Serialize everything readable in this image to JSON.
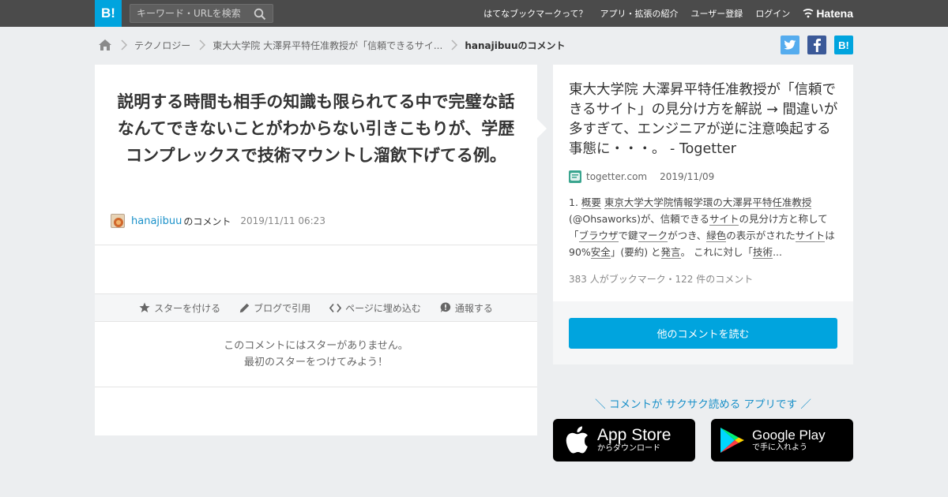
{
  "header": {
    "logo_text": "B!",
    "search_placeholder": "キーワード・URLを検索",
    "nav": [
      "はてなブックマークって？",
      "アプリ・拡張の紹介",
      "ユーザー登録",
      "ログイン"
    ],
    "brand": "Hatena"
  },
  "breadcrumb": {
    "items": [
      "テクノロジー",
      "東大大学院 大澤昇平特任准教授が「信頼できるサイ..."
    ],
    "current": "hanajibuuのコメント"
  },
  "share": {
    "hatena": "B!"
  },
  "comment": {
    "text": "説明する時間も相手の知識も限られてる中で完璧な話なんてできないことがわからない引きこもりが、学歴コンプレックスで技術マウントし溜飲下げてる例。",
    "user": "hanajibuu",
    "user_suffix": "のコメント",
    "time": "2019/11/11 06:23"
  },
  "actions": {
    "star": "スターを付ける",
    "blog": "ブログで引用",
    "embed": "ページに埋め込む",
    "report": "通報する"
  },
  "no_stars": {
    "line1": "このコメントにはスターがありません。",
    "line2": "最初のスターをつけてみよう！"
  },
  "entry": {
    "title": "東大大学院 大澤昇平特任准教授が「信頼できるサイト」の見分け方を解説 → 間違いが多すぎて、エンジニアが逆に注意喚起する事態に・・・。 - Togetter",
    "domain": "togetter.com",
    "date": "2019/11/09",
    "summary": {
      "s1": "1. ",
      "u1": "概要",
      "s2": " ",
      "u2": "東京大学大学院情報学環の大澤昇平特任准教授",
      "s3": "(@Ohsaworks)が、信頼できる",
      "u3": "サイト",
      "s4": "の見分け方と称して「",
      "u4": "ブラウザ",
      "s5": "で鍵",
      "u5": "マーク",
      "s6": "がつき、",
      "u6": "緑色",
      "s7": "の表示がされた",
      "u7": "サイト",
      "s8": "は90%",
      "u8": "安全",
      "s9": "」(要約) と",
      "u9": "発言",
      "s10": "。 これに対し「",
      "u10": "技術",
      "s11": "..."
    },
    "counts": "383 人がブックマーク・122 件のコメント",
    "more_button": "他のコメントを読む"
  },
  "app_promo": {
    "tagline": "＼ コメントが サクサク読める アプリです ／",
    "appstore_main": "App Store",
    "appstore_sub": "からダウンロード",
    "googleplay_main": "Google Play",
    "googleplay_sub": "で手に入れよう"
  },
  "colors": {
    "topbar": "#4b4b4b",
    "brand_blue": "#00a4de",
    "link_blue": "#1b91c9",
    "twitter": "#55acee",
    "facebook": "#3b5998"
  }
}
